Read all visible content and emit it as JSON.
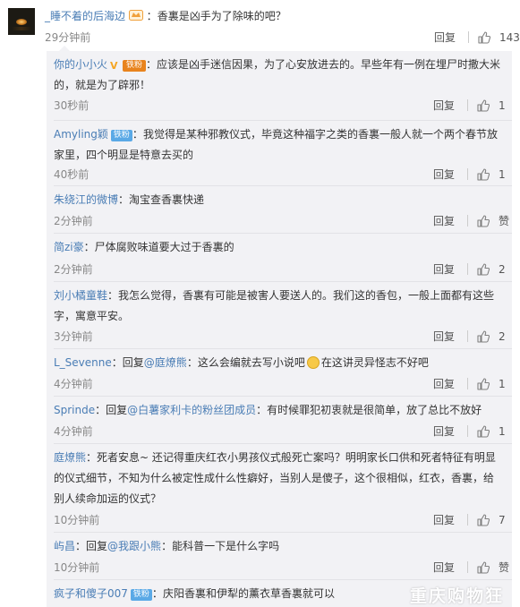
{
  "main_comment": {
    "username": "_睡不着的后海边",
    "separator": "：",
    "text": "香裏是凶手为了除味的吧？",
    "time": "29分钟前",
    "reply_label": "回复",
    "likes": "143"
  },
  "replies": [
    {
      "username": "你的小小火",
      "badge": "铁粉",
      "sep": "：",
      "text": "应该是凶手迷信因果，为了心安放进去的。早些年有一例在埋尸时撒大米的，就是为了辟邪！",
      "time": "30秒前",
      "reply_label": "回复",
      "likes": "1"
    },
    {
      "username": "Amyling颖",
      "badge": "铁粉",
      "sep": "：",
      "text": "我觉得是某种邪教仪式，毕竟这种福字之类的香裏一般人就一个两个春节放家里，四个明显是特意去买的",
      "time": "40秒前",
      "reply_label": "回复",
      "likes": "1"
    },
    {
      "username": "朱绕江的微博",
      "sep": "：",
      "text": "淘宝查香裏快递",
      "time": "2分钟前",
      "reply_label": "回复",
      "likes": "赞"
    },
    {
      "username": "简zi豪",
      "sep": "：",
      "text": "尸体腐败味道要大过于香裏的",
      "time": "2分钟前",
      "reply_label": "回复",
      "likes": "2"
    },
    {
      "username": "刘小橘童鞋",
      "sep": "：",
      "text": "我怎么觉得，香裏有可能是被害人要送人的。我们这的香包，一般上面都有这些字，寓意平安。",
      "time": "3分钟前",
      "reply_label": "回复",
      "likes": "2"
    },
    {
      "username": "L_Sevenne",
      "sep": "：",
      "pre": "回复",
      "mention": "@庭燎熊",
      "text_a": "这么会编就去写小说吧",
      "text_b": "在这讲灵异怪志不好吧",
      "time": "4分钟前",
      "reply_label": "回复",
      "likes": "1"
    },
    {
      "username": "Sprinde",
      "sep": "：",
      "pre": "回复",
      "mention": "@白薯家利卡的粉丝团成员",
      "text": "有时候罪犯初衷就是很简单，放了总比不放好",
      "time": "4分钟前",
      "reply_label": "回复",
      "likes": "1"
    },
    {
      "username": "庭燎熊",
      "sep": "：",
      "text": "死者安息~ 还记得重庆红衣小男孩仪式般死亡案吗？明明家长口供和死者特征有明显的仪式细节，不知为什么被定性成什么性癖好，当别人是傻子，这个很相似，红衣，香裏，给别人续命加运的仪式？",
      "time": "10分钟前",
      "reply_label": "回复",
      "likes": "7"
    },
    {
      "username": "屿昌",
      "sep": "：",
      "pre": "回复",
      "mention": "@我跟小熊",
      "text": "能科普一下是什么字吗",
      "time": "10分钟前",
      "reply_label": "回复",
      "likes": "赞"
    },
    {
      "username": "疯子和傻子007",
      "badge": "铁粉",
      "sep": "：",
      "text": "庆阳香裏和伊犁的薰衣草香裏就可以"
    }
  ],
  "watermark": "重庆购物狂"
}
